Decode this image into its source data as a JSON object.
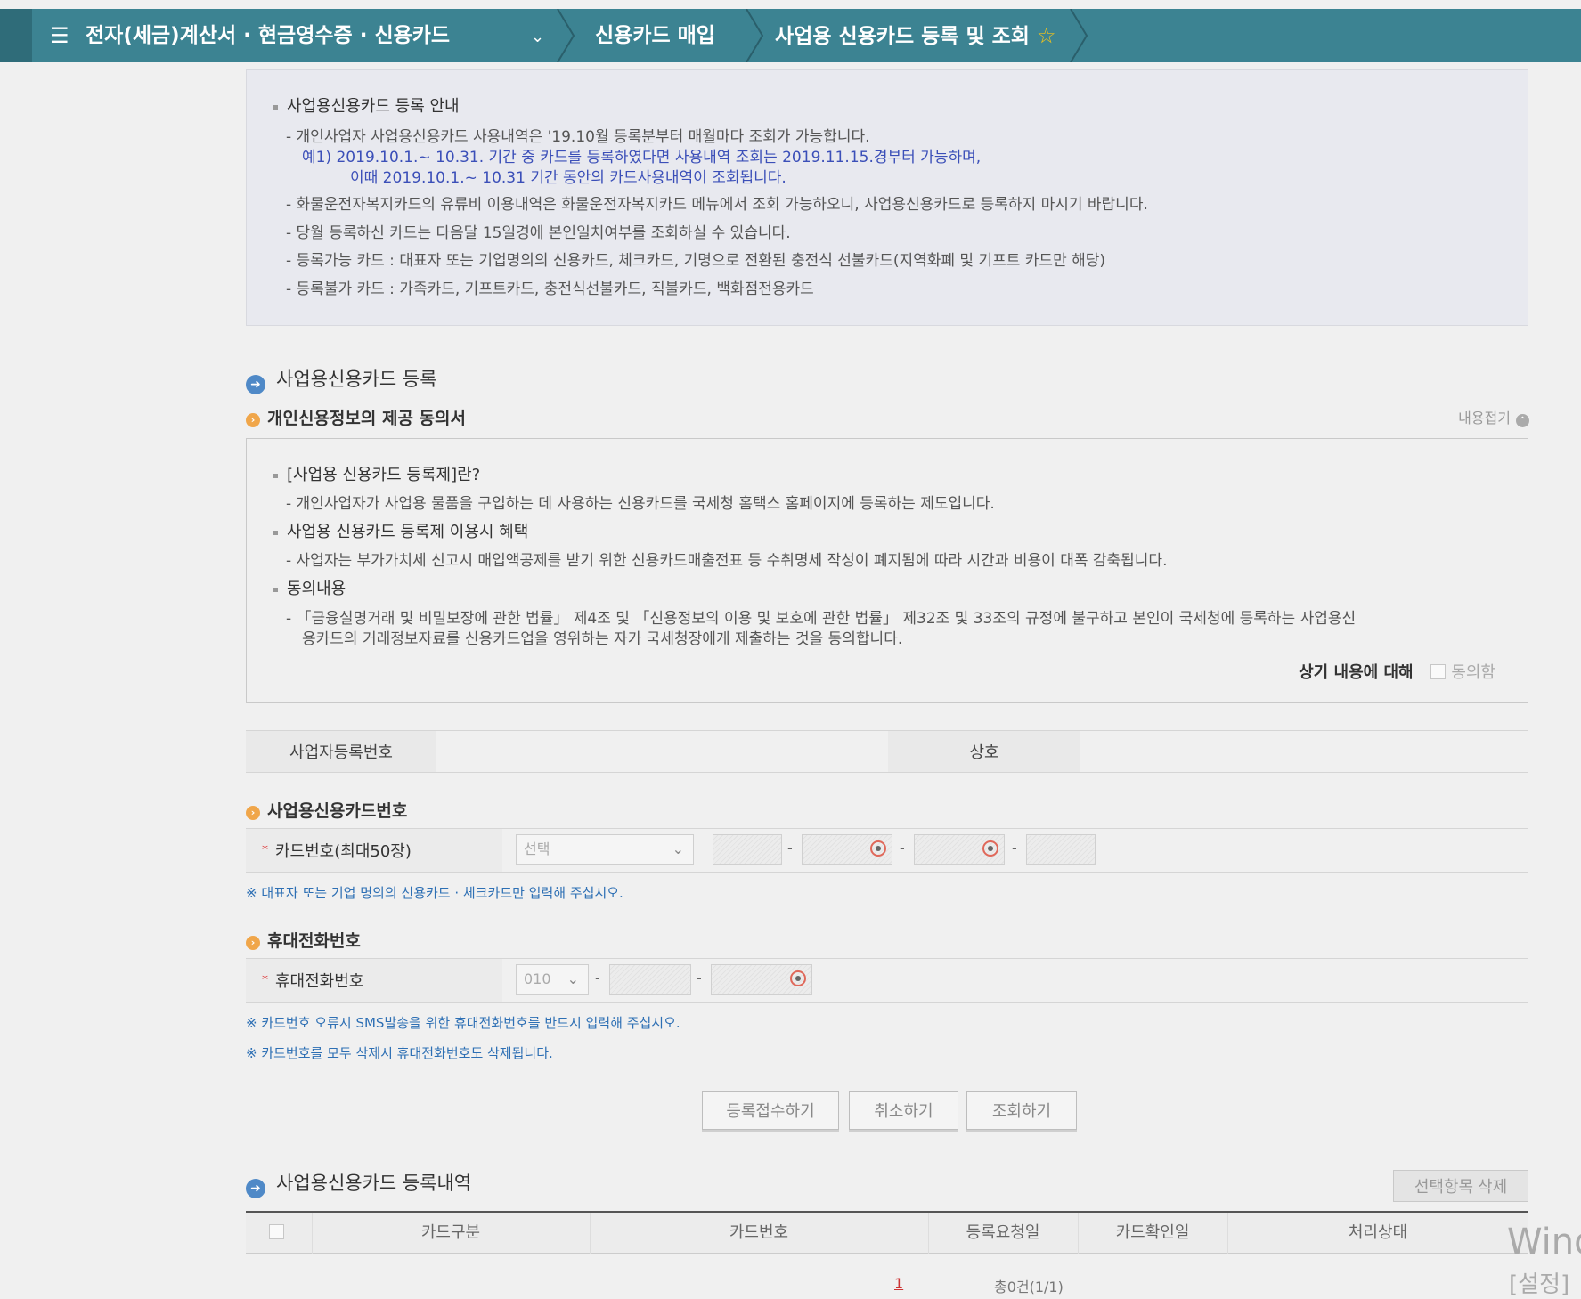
{
  "header": {
    "menu_icon": "☰",
    "crumb1": "전자(세금)계산서 · 현금영수증 · 신용카드",
    "crumb2": "신용카드 매입",
    "crumb3": "사업용 신용카드 등록 및 조회",
    "star": "☆"
  },
  "guide": {
    "title": "사업용신용카드 등록 안내",
    "lines": [
      "- 개인사업자 사업용신용카드 사용내역은 '19.10월 등록분부터 매월마다 조회가 가능합니다.",
      "예1) 2019.10.1.~ 10.31. 기간 중 카드를 등록하였다면 사용내역 조회는 2019.11.15.경부터 가능하며,",
      "이때 2019.10.1.~ 10.31 기간 동안의 카드사용내역이 조회됩니다.",
      "- 화물운전자복지카드의 유류비 이용내역은 화물운전자복지카드 메뉴에서 조회 가능하오니, 사업용신용카드로 등록하지 마시기 바랍니다.",
      "- 당월 등록하신 카드는 다음달 15일경에 본인일치여부를 조회하실 수 있습니다.",
      "- 등록가능 카드 : 대표자 또는 기업명의의 신용카드, 체크카드, 기명으로 전환된 충전식 선불카드(지역화폐 및 기프트 카드만 해당)",
      "- 등록불가 카드 : 가족카드, 기프트카드, 충전식선불카드, 직불카드, 백화점전용카드"
    ]
  },
  "register": {
    "title": "사업용신용카드 등록",
    "consent_title": "개인신용정보의 제공 동의서",
    "fold_label": "내용접기",
    "q1": "[사업용 신용카드 등록제]란?",
    "a1": "- 개인사업자가 사업용 물품을 구입하는 데 사용하는 신용카드를 국세청 홈택스 홈페이지에 등록하는 제도입니다.",
    "q2": "사업용 신용카드 등록제 이용시 혜택",
    "a2": "- 사업자는 부가가치세 신고시 매입액공제를 받기 위한 신용카드매출전표 등 수취명세 작성이 폐지됨에 따라 시간과 비용이 대폭 감축됩니다.",
    "q3": "동의내용",
    "a3a": "- 「금융실명거래 및 비밀보장에 관한 법률」 제4조 및 「신용정보의 이용 및 보호에 관한 법률」 제32조 및 33조의 규정에 불구하고 본인이 국세청에 등록하는 사업용신",
    "a3b": "용카드의    거래정보자료를 신용카드업을 영위하는 자가 국세청장에게 제출하는 것을 동의합니다.",
    "agree_label": "상기 내용에 대해",
    "agree_check": "동의함",
    "biz_no_label": "사업자등록번호",
    "biz_name_label": "상호",
    "card_section": "사업용신용카드번호",
    "card_label": "카드번호(최대50장)",
    "card_select": "선택",
    "card_note": "※ 대표자 또는 기업 명의의 신용카드 · 체크카드만 입력해 주십시오.",
    "phone_section": "휴대전화번호",
    "phone_label": "휴대전화번호",
    "phone_prefix": "010",
    "phone_note1": "※ 카드번호 오류시 SMS발송을 위한 휴대전화번호를 반드시 입력해 주십시오.",
    "phone_note2": "※ 카드번호를 모두 삭제시 휴대전화번호도 삭제됩니다.",
    "btn_submit": "등록접수하기",
    "btn_cancel": "취소하기",
    "btn_search": "조회하기"
  },
  "history": {
    "title": "사업용신용카드 등록내역",
    "delete_btn": "선택항목 삭제",
    "columns": [
      "카드구분",
      "카드번호",
      "등록요청일",
      "카드확인일",
      "처리상태"
    ],
    "page": "1",
    "total": "총0건(1/1)"
  },
  "watermark": {
    "line1": "Wind",
    "line2": "[설정]"
  }
}
